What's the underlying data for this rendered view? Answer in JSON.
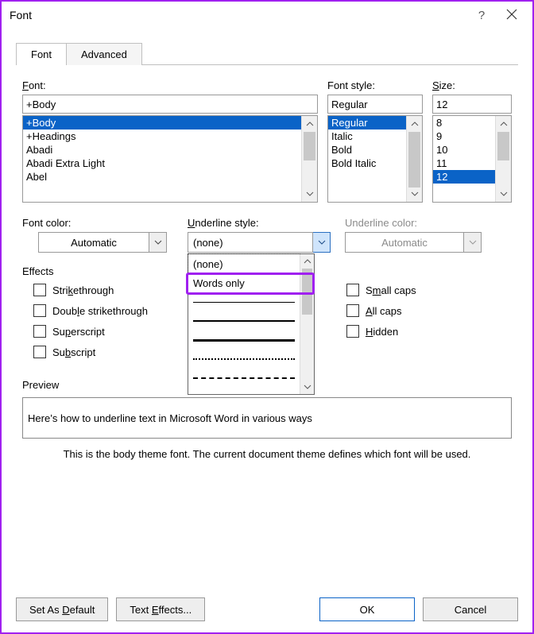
{
  "window": {
    "title": "Font",
    "help": "?",
    "close": "×"
  },
  "tabs": {
    "font": "Font",
    "advanced": "Advanced"
  },
  "font": {
    "label": "Font:",
    "value": "+Body",
    "items": [
      "+Body",
      "+Headings",
      "Abadi",
      "Abadi Extra Light",
      "Abel"
    ],
    "selected": "+Body"
  },
  "fontStyle": {
    "label": "Font style:",
    "value": "Regular",
    "items": [
      "Regular",
      "Italic",
      "Bold",
      "Bold Italic"
    ],
    "selected": "Regular"
  },
  "size": {
    "label": "Size:",
    "value": "12",
    "items": [
      "8",
      "9",
      "10",
      "11",
      "12"
    ],
    "selected": "12"
  },
  "fontColor": {
    "label": "Font color:",
    "value": "Automatic"
  },
  "underlineStyle": {
    "label": "Underline style:",
    "value": "(none)",
    "options": [
      "(none)",
      "Words only"
    ]
  },
  "underlineColor": {
    "label": "Underline color:",
    "value": "Automatic"
  },
  "effects": {
    "label": "Effects",
    "left": [
      "Strikethrough",
      "Double strikethrough",
      "Superscript",
      "Subscript"
    ],
    "right": [
      "Small caps",
      "All caps",
      "Hidden"
    ]
  },
  "preview": {
    "label": "Preview",
    "text": "Here’s how to underline text in Microsoft Word in various ways",
    "note": "This is the body theme font. The current document theme defines which font will be used."
  },
  "buttons": {
    "setDefault": "Set As Default",
    "textEffects": "Text Effects...",
    "ok": "OK",
    "cancel": "Cancel"
  }
}
